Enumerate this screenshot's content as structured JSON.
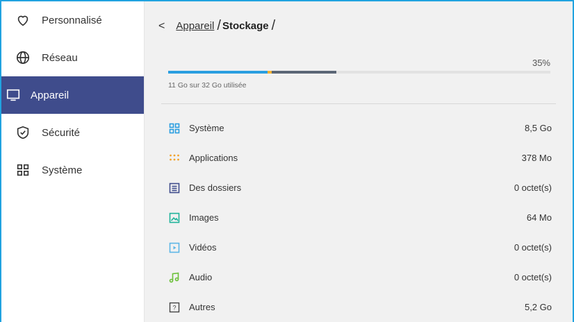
{
  "sidebar": {
    "items": [
      {
        "label": "Personnalisé",
        "icon": "heart-icon"
      },
      {
        "label": "Réseau",
        "icon": "globe-icon"
      },
      {
        "label": "Appareil",
        "icon": "monitor-icon",
        "active": true
      },
      {
        "label": "Sécurité",
        "icon": "shield-check-icon"
      },
      {
        "label": "Système",
        "icon": "grid-icon"
      }
    ]
  },
  "breadcrumb": {
    "back": "<",
    "parent": "Appareil",
    "separator": "/",
    "current": "Stockage",
    "trailing": "/"
  },
  "storage": {
    "percent_label": "35%",
    "usage_label": "11 Go sur 32 Go utilisée",
    "segments": [
      {
        "color": "#2a9ee0",
        "fraction": 0.26
      },
      {
        "color": "#f2b233",
        "fraction": 0.01
      },
      {
        "color": "#5b6676",
        "fraction": 0.17
      }
    ]
  },
  "categories": [
    {
      "label": "Système",
      "value": "8,5 Go",
      "icon": "grid-icon",
      "color": "#2a9ee0"
    },
    {
      "label": "Applications",
      "value": "378 Mo",
      "icon": "apps-dots-icon",
      "color": "#f2a22b"
    },
    {
      "label": "Des dossiers",
      "value": "0 octet(s)",
      "icon": "document-icon",
      "color": "#3f4c8c"
    },
    {
      "label": "Images",
      "value": "64 Mo",
      "icon": "image-icon",
      "color": "#1eb39a"
    },
    {
      "label": "Vidéos",
      "value": "0 octet(s)",
      "icon": "video-icon",
      "color": "#5db6e6"
    },
    {
      "label": "Audio",
      "value": "0 octet(s)",
      "icon": "music-icon",
      "color": "#6cc03a"
    },
    {
      "label": "Autres",
      "value": "5,2 Go",
      "icon": "question-icon",
      "color": "#444444"
    }
  ]
}
